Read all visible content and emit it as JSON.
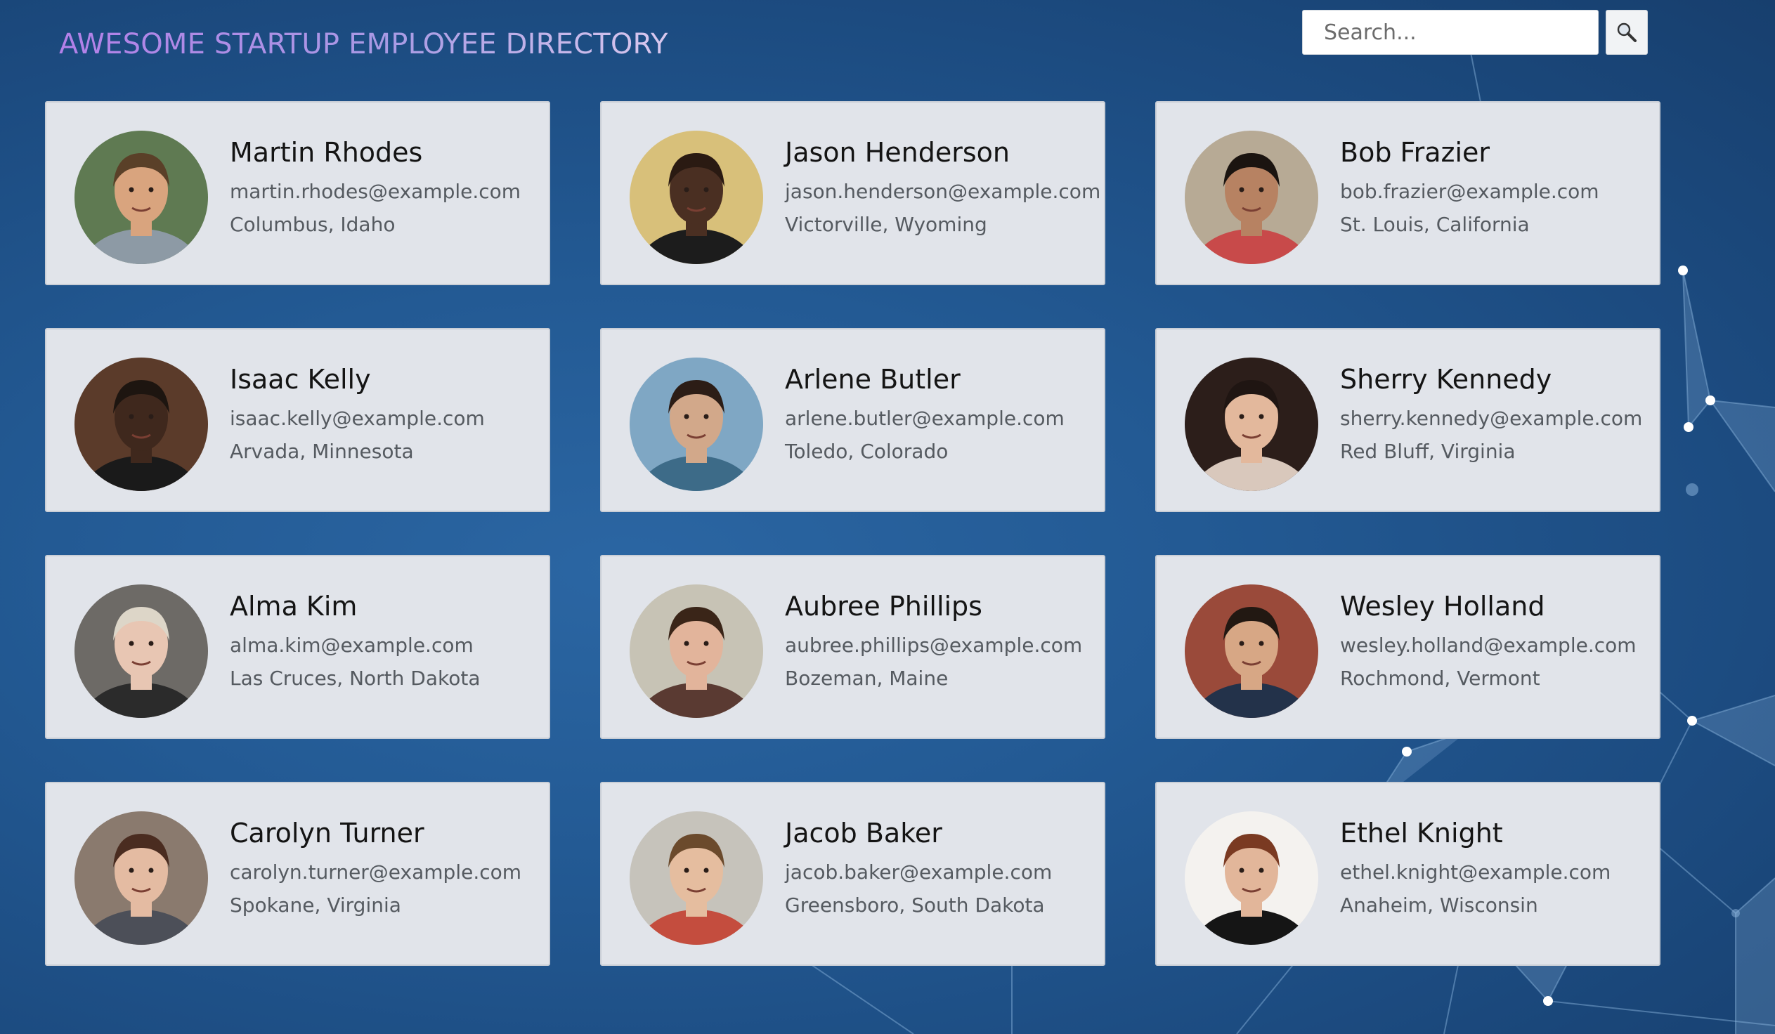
{
  "header": {
    "title": "AWESOME STARTUP EMPLOYEE DIRECTORY"
  },
  "search": {
    "placeholder": "Search...",
    "button_icon": "magnifier-icon"
  },
  "colors": {
    "background": "#235a94",
    "card_background": "#e1e4ea",
    "title_gradient_start": "#b380e8",
    "title_gradient_end": "#d9c8ee"
  },
  "employees": [
    {
      "name": "Martin Rhodes",
      "email": "martin.rhodes@example.com",
      "location": "Columbus, Idaho",
      "avatar": {
        "bg": "#5f7a52",
        "skin": "#d9a47e",
        "hair": "#5a4028",
        "shirt": "#8d9aa5"
      }
    },
    {
      "name": "Jason Henderson",
      "email": "jason.henderson@example.com",
      "location": "Victorville, Wyoming",
      "avatar": {
        "bg": "#d8c07a",
        "skin": "#4a2f22",
        "hair": "#2a1a12",
        "shirt": "#1c1c1c"
      }
    },
    {
      "name": "Bob Frazier",
      "email": "bob.frazier@example.com",
      "location": "St. Louis, California",
      "avatar": {
        "bg": "#b7aa95",
        "skin": "#b78262",
        "hair": "#1b1410",
        "shirt": "#c84a4a"
      }
    },
    {
      "name": "Isaac Kelly",
      "email": "isaac.kelly@example.com",
      "location": "Arvada, Minnesota",
      "avatar": {
        "bg": "#5b3b2a",
        "skin": "#3f281d",
        "hair": "#1d1510",
        "shirt": "#1a1a1a"
      }
    },
    {
      "name": "Arlene Butler",
      "email": "arlene.butler@example.com",
      "location": "Toledo, Colorado",
      "avatar": {
        "bg": "#7fa7c4",
        "skin": "#d2a88a",
        "hair": "#2c1d16",
        "shirt": "#3d6b88"
      }
    },
    {
      "name": "Sherry Kennedy",
      "email": "sherry.kennedy@example.com",
      "location": "Red Bluff, Virginia",
      "avatar": {
        "bg": "#2c1e1a",
        "skin": "#e3b89c",
        "hair": "#1f1512",
        "shirt": "#d9c8bc"
      }
    },
    {
      "name": "Alma Kim",
      "email": "alma.kim@example.com",
      "location": "Las Cruces, North Dakota",
      "avatar": {
        "bg": "#6d6a66",
        "skin": "#e8c6b3",
        "hair": "#ddd6c8",
        "shirt": "#2b2b2b"
      }
    },
    {
      "name": "Aubree Phillips",
      "email": "aubree.phillips@example.com",
      "location": "Bozeman, Maine",
      "avatar": {
        "bg": "#c7c3b5",
        "skin": "#e2b49b",
        "hair": "#3a2518",
        "shirt": "#5a3a32"
      }
    },
    {
      "name": "Wesley Holland",
      "email": "wesley.holland@example.com",
      "location": "Rochmond, Vermont",
      "avatar": {
        "bg": "#9a4a3a",
        "skin": "#d7a785",
        "hair": "#221812",
        "shirt": "#23324a"
      }
    },
    {
      "name": "Carolyn Turner",
      "email": "carolyn.turner@example.com",
      "location": "Spokane, Virginia",
      "avatar": {
        "bg": "#8a7a6e",
        "skin": "#e4bba2",
        "hair": "#4a2c20",
        "shirt": "#4c4f58"
      }
    },
    {
      "name": "Jacob Baker",
      "email": "jacob.baker@example.com",
      "location": "Greensboro, South Dakota",
      "avatar": {
        "bg": "#c6c3bb",
        "skin": "#e5bd9f",
        "hair": "#6b4a2c",
        "shirt": "#c44d3e"
      }
    },
    {
      "name": "Ethel Knight",
      "email": "ethel.knight@example.com",
      "location": "Anaheim, Wisconsin",
      "avatar": {
        "bg": "#f4f2ef",
        "skin": "#e2b69a",
        "hair": "#7a3a22",
        "shirt": "#151515"
      }
    }
  ]
}
